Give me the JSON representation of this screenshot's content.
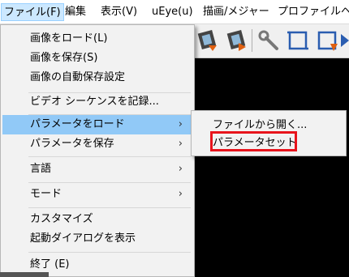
{
  "menubar": {
    "items": [
      {
        "label": "ファイル(F)"
      },
      {
        "label": "編集"
      },
      {
        "label": "表示(V)"
      },
      {
        "label": "uEye(u)"
      },
      {
        "label": "描画/メジャー"
      },
      {
        "label": "プロファイル"
      },
      {
        "label": "ヘ"
      }
    ]
  },
  "toolbar": {
    "icons": [
      "film-record-icon",
      "film-play-icon",
      "wrench-icon",
      "crop-frame-icon",
      "crop-frame-icon",
      "arrow-icon"
    ]
  },
  "file_menu": {
    "items": [
      {
        "label": "画像をロード(L)"
      },
      {
        "label": "画像を保存(S)"
      },
      {
        "label": "画像の自動保存設定"
      },
      {
        "label": "ビデオ シーケンスを記録..."
      },
      {
        "label": "パラメータをロード",
        "submenu_arrow": "›"
      },
      {
        "label": "パラメータを保存",
        "submenu_arrow": "›"
      },
      {
        "label": "言語",
        "submenu_arrow": "›"
      },
      {
        "label": "モード",
        "submenu_arrow": "›"
      },
      {
        "label": "カスタマイズ"
      },
      {
        "label": "起動ダイアログを表示"
      },
      {
        "label": "終了 (E)"
      }
    ]
  },
  "load_params_submenu": {
    "items": [
      {
        "label": "ファイルから開く..."
      },
      {
        "label": "パラメータセット"
      }
    ]
  },
  "colors": {
    "highlight": "#91c9f7",
    "annotation_box": "#e8141c",
    "menubar_active": "#cce8ff"
  }
}
